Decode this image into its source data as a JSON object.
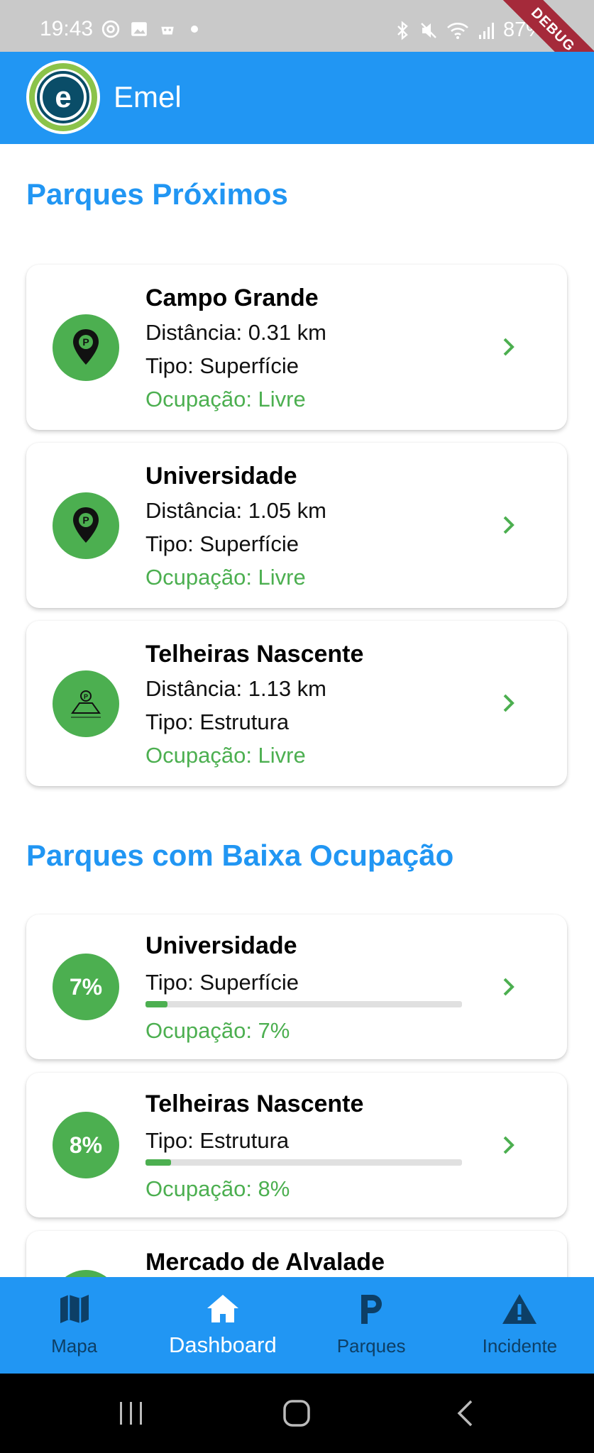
{
  "status_bar": {
    "time": "19:43",
    "battery": "87%",
    "debug_banner": "DEBUG"
  },
  "app_bar": {
    "title": "Emel",
    "logo_letter": "e"
  },
  "sections": {
    "nearby": {
      "title": "Parques Próximos",
      "items": [
        {
          "name": "Campo Grande",
          "distance": "Distância: 0.31 km",
          "type": "Tipo: Superfície",
          "occupancy": "Ocupação: Livre",
          "icon": "parking-pin-icon"
        },
        {
          "name": "Universidade",
          "distance": "Distância: 1.05 km",
          "type": "Tipo: Superfície",
          "occupancy": "Ocupação: Livre",
          "icon": "parking-pin-icon"
        },
        {
          "name": "Telheiras Nascente",
          "distance": "Distância: 1.13 km",
          "type": "Tipo: Estrutura",
          "occupancy": "Ocupação: Livre",
          "icon": "parking-structure-icon"
        }
      ]
    },
    "low_occupancy": {
      "title": "Parques com Baixa Ocupação",
      "items": [
        {
          "badge": "7%",
          "name": "Universidade",
          "type": "Tipo: Superfície",
          "occupancy": "Ocupação: 7%",
          "fill": 0.07
        },
        {
          "badge": "8%",
          "name": "Telheiras Nascente",
          "type": "Tipo: Estrutura",
          "occupancy": "Ocupação: 8%",
          "fill": 0.08
        },
        {
          "badge": "",
          "name": "Mercado de Alvalade",
          "type": "",
          "occupancy": "",
          "fill": 0
        }
      ]
    }
  },
  "bottom_nav": {
    "items": [
      {
        "label": "Mapa",
        "icon": "map-icon"
      },
      {
        "label": "Dashboard",
        "icon": "home-icon",
        "active": true
      },
      {
        "label": "Parques",
        "icon": "parking-p-icon"
      },
      {
        "label": "Incidente",
        "icon": "warning-icon"
      }
    ]
  },
  "colors": {
    "primary": "#2196f3",
    "success": "#4caf50",
    "nav_inactive": "#0d3f66"
  }
}
